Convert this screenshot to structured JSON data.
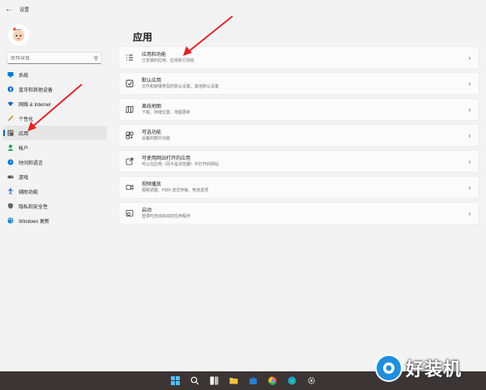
{
  "window": {
    "title": "设置"
  },
  "sidebar": {
    "search_placeholder": "查找设置",
    "items": [
      {
        "label": "系统",
        "icon": "monitor-icon",
        "color": "#0078d4",
        "active": false
      },
      {
        "label": "蓝牙和其他设备",
        "icon": "bluetooth-icon",
        "color": "#0067c0",
        "active": false
      },
      {
        "label": "网络 & Internet",
        "icon": "wifi-icon",
        "color": "#2b6cb0",
        "active": false
      },
      {
        "label": "个性化",
        "icon": "brush-icon",
        "color": "#d47a00",
        "active": false
      },
      {
        "label": "应用",
        "icon": "apps-icon",
        "color": "#555555",
        "active": true
      },
      {
        "label": "帐户",
        "icon": "person-icon",
        "color": "#1e9e55",
        "active": false
      },
      {
        "label": "时间和语言",
        "icon": "globe-clock-icon",
        "color": "#0078d4",
        "active": false
      },
      {
        "label": "游戏",
        "icon": "gamepad-icon",
        "color": "#555555",
        "active": false
      },
      {
        "label": "辅助功能",
        "icon": "accessibility-icon",
        "color": "#1b6ac9",
        "active": false
      },
      {
        "label": "隐私和安全性",
        "icon": "shield-icon",
        "color": "#666666",
        "active": false
      },
      {
        "label": "Windows 更新",
        "icon": "update-icon",
        "color": "#0078d4",
        "active": false
      }
    ]
  },
  "main": {
    "title": "应用",
    "cards": [
      {
        "title": "应用和功能",
        "desc": "已安装的应用、应用执行别名",
        "icon": "apps-list-icon"
      },
      {
        "title": "默认应用",
        "desc": "文件和链接类型的默认设置，其他默认设置",
        "icon": "default-apps-icon"
      },
      {
        "title": "离线地图",
        "desc": "下载、存储位置、地图更新",
        "icon": "map-icon"
      },
      {
        "title": "可选功能",
        "desc": "设备的额外功能",
        "icon": "optional-features-icon"
      },
      {
        "title": "可使用网站打开的应用",
        "desc": "可以在应用（而不是浏览器）中打开的网站",
        "icon": "open-with-icon"
      },
      {
        "title": "视频播放",
        "desc": "视频调整、HDR 流式传输、电池选项",
        "icon": "video-icon"
      },
      {
        "title": "启动",
        "desc": "登录时自动启动的应用程序",
        "icon": "startup-icon"
      }
    ]
  },
  "taskbar": {
    "background": "#3c3535",
    "icons": [
      "windows-start-icon",
      "search-icon",
      "task-view-icon",
      "file-explorer-icon",
      "store-icon",
      "chrome-icon",
      "edge-icon",
      "settings-icon"
    ]
  },
  "watermark": {
    "text": "好装机"
  },
  "accent": "#005fb8",
  "annotation_color": "#e02525"
}
